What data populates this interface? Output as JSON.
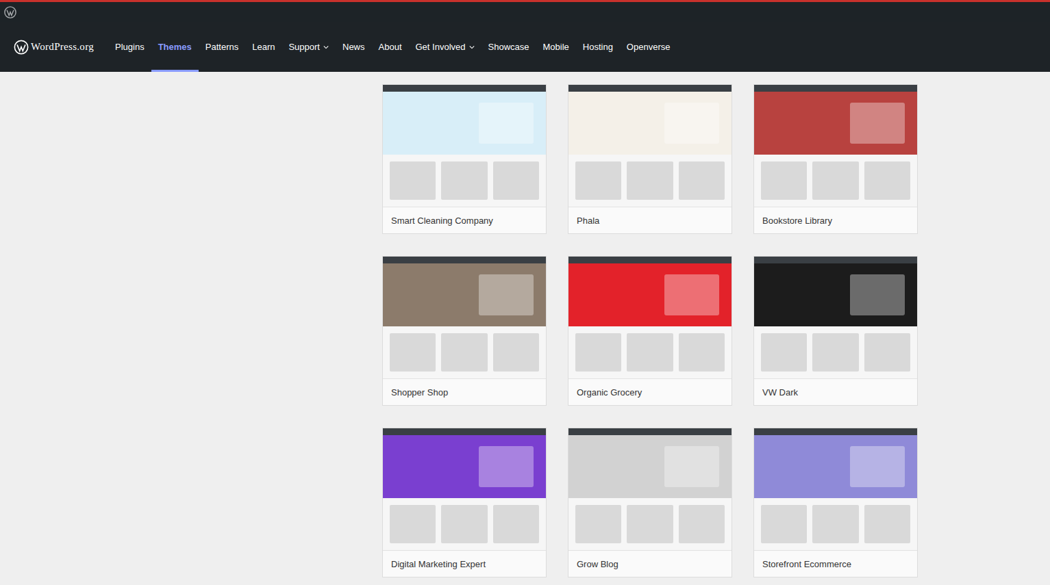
{
  "site": {
    "logo": "WordPress.org"
  },
  "nav": [
    {
      "label": "Plugins",
      "selected": false,
      "hasMenu": false
    },
    {
      "label": "Themes",
      "selected": true,
      "hasMenu": false
    },
    {
      "label": "Patterns",
      "selected": false,
      "hasMenu": false
    },
    {
      "label": "Learn",
      "selected": false,
      "hasMenu": false
    },
    {
      "label": "Support",
      "selected": false,
      "hasMenu": true
    },
    {
      "label": "News",
      "selected": false,
      "hasMenu": false
    },
    {
      "label": "About",
      "selected": false,
      "hasMenu": false
    },
    {
      "label": "Get Involved",
      "selected": false,
      "hasMenu": true
    },
    {
      "label": "Showcase",
      "selected": false,
      "hasMenu": false
    },
    {
      "label": "Mobile",
      "selected": false,
      "hasMenu": false
    },
    {
      "label": "Hosting",
      "selected": false,
      "hasMenu": false
    },
    {
      "label": "Openverse",
      "selected": false,
      "hasMenu": false
    }
  ],
  "themes": [
    {
      "name": "Smart Cleaning Company",
      "color": "#d8eef8"
    },
    {
      "name": "Phala",
      "color": "#f4f0e8"
    },
    {
      "name": "Bookstore Library",
      "color": "#b8423f"
    },
    {
      "name": "Shopper Shop",
      "color": "#8c7b6b"
    },
    {
      "name": "Organic Grocery",
      "color": "#e3222a"
    },
    {
      "name": "VW Dark",
      "color": "#1c1c1c"
    },
    {
      "name": "Digital Marketing Expert",
      "color": "#7a3fd0"
    },
    {
      "name": "Grow Blog",
      "color": "#d2d2d2"
    },
    {
      "name": "Storefront Ecommerce",
      "color": "#8f8ad8"
    }
  ]
}
